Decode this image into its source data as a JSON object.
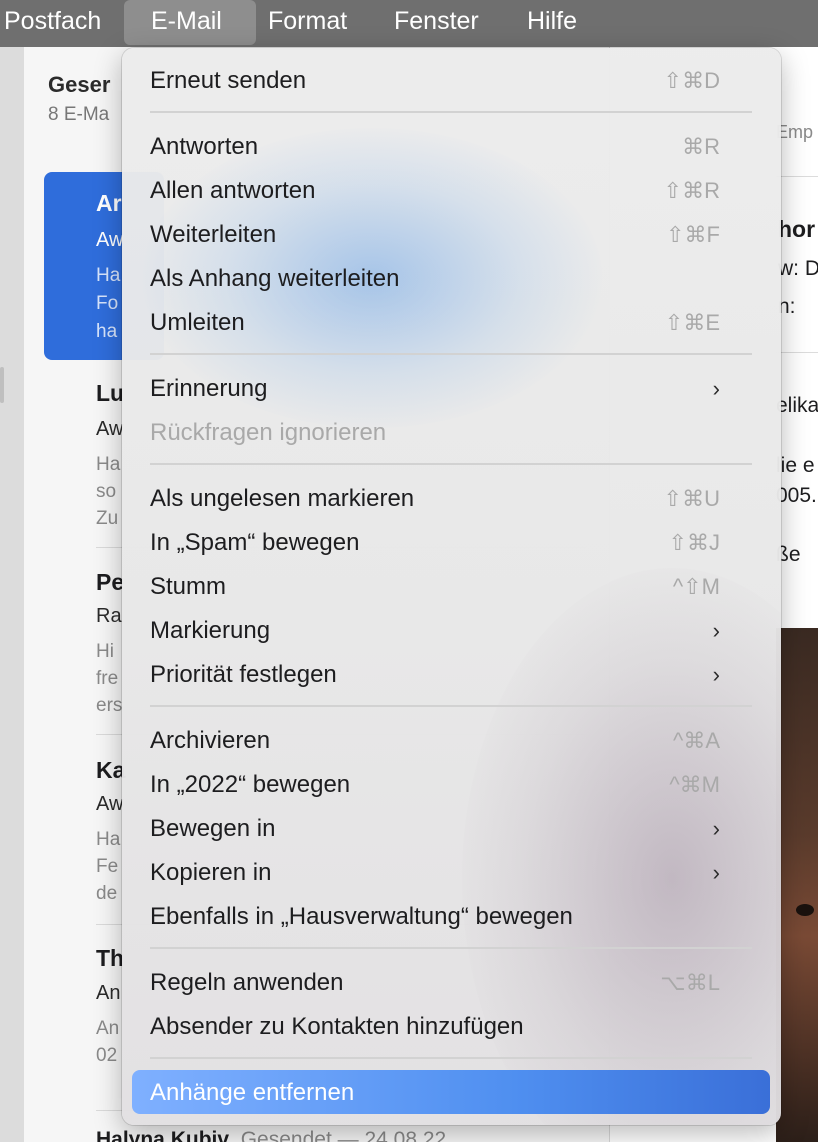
{
  "menubar": {
    "items": [
      "Postfach",
      "E-Mail",
      "Format",
      "Fenster",
      "Hilfe"
    ],
    "active": "E-Mail"
  },
  "list": {
    "title": "Geser",
    "subtitle": "8 E-Ma",
    "selected": {
      "l1": "Ar",
      "l2": "Aw",
      "l3a": "Ha",
      "l3b": "Fo",
      "l3c": "ha"
    },
    "messages": [
      {
        "l1": "Lu",
        "l2": "Aw",
        "l3a": "Ha",
        "l3b": "so",
        "l3c": "Zu"
      },
      {
        "l1": "Pe",
        "l2": "Ra",
        "l3a": "Hi",
        "l3b": "fre",
        "l3c": "ers"
      },
      {
        "l1": "Ka",
        "l2": "Aw",
        "l3a": "Ha",
        "l3b": "Fe",
        "l3c": "de"
      },
      {
        "l1": "Th",
        "l2": "An",
        "l3a": "An",
        "l3b": "02",
        "l3c": ""
      }
    ],
    "last_row": {
      "name": "Halyna Kubiv",
      "meta": "Gesendet — 24.08.22"
    }
  },
  "detail": {
    "header_label": "Emp",
    "from_name": "hor",
    "row1": "w: D",
    "row2": "n:",
    "body1": "elika",
    "body2": "lie e",
    "body3": "005.",
    "body4": "ße"
  },
  "menu": {
    "items": [
      {
        "label": "Erneut senden",
        "shortcut": "⇧⌘D"
      },
      {
        "label": "Antworten",
        "shortcut": "⌘R"
      },
      {
        "label": "Allen antworten",
        "shortcut": "⇧⌘R"
      },
      {
        "label": "Weiterleiten",
        "shortcut": "⇧⌘F"
      },
      {
        "label": "Als Anhang weiterleiten",
        "shortcut": ""
      },
      {
        "label": "Umleiten",
        "shortcut": "⇧⌘E"
      },
      {
        "label": "Erinnerung",
        "submenu": true
      },
      {
        "label": "Rückfragen ignorieren",
        "disabled": true
      },
      {
        "label": "Als ungelesen markieren",
        "shortcut": "⇧⌘U"
      },
      {
        "label": "In „Spam“ bewegen",
        "shortcut": "⇧⌘J"
      },
      {
        "label": "Stumm",
        "shortcut": "^⇧M"
      },
      {
        "label": "Markierung",
        "submenu": true
      },
      {
        "label": "Priorität festlegen",
        "submenu": true
      },
      {
        "label": "Archivieren",
        "shortcut": "^⌘A"
      },
      {
        "label": "In „2022“ bewegen",
        "shortcut": "^⌘M"
      },
      {
        "label": "Bewegen in",
        "submenu": true
      },
      {
        "label": "Kopieren in",
        "submenu": true
      },
      {
        "label": "Ebenfalls in „Hausverwaltung“ bewegen",
        "shortcut": ""
      },
      {
        "label": "Regeln anwenden",
        "shortcut": "⌥⌘L"
      },
      {
        "label": "Absender zu Kontakten hinzufügen",
        "shortcut": ""
      },
      {
        "label": "Anhänge entfernen",
        "highlighted": true
      }
    ],
    "chevron_icon": "chevron-right-icon"
  }
}
